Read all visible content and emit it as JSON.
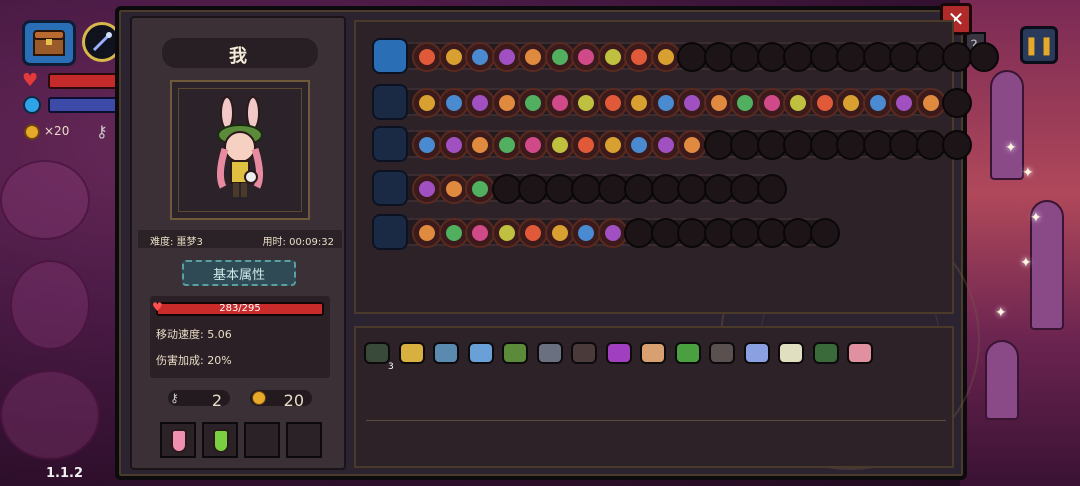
{
  "hud": {
    "coins": "×20",
    "version": "1.1.2"
  },
  "character": {
    "name": "我",
    "difficulty": "难度: 噩梦3",
    "time": "用时: 00:09:32",
    "attr_tab": "基本属性",
    "hp": "283/295",
    "move_speed": "移动速度: 5.06",
    "damage_bonus": "伤害加成: 20%",
    "keys": "2",
    "gold": "20"
  },
  "colors": {
    "hp": "#c92a2a",
    "mana": "#3d4aa8",
    "accent": "#e7a92a",
    "panel": "#2d2228"
  },
  "weapon_rows": [
    {
      "icon": "chest-icon",
      "main": true,
      "slots": 22,
      "filled": 10
    },
    {
      "icon": "wand-icon",
      "main": false,
      "slots": 21,
      "filled": 20
    },
    {
      "icon": "spear-icon",
      "main": false,
      "slots": 21,
      "filled": 11
    },
    {
      "icon": "gauntlet-icon",
      "main": false,
      "slots": 14,
      "filled": 3
    },
    {
      "icon": "staff-icon",
      "main": false,
      "slots": 16,
      "filled": 8
    }
  ],
  "items": [
    {
      "name": "armor-item",
      "color": "#3a4a3a",
      "count": "3"
    },
    {
      "name": "antler-item",
      "color": "#d8b040",
      "count": ""
    },
    {
      "name": "magnifier-item",
      "color": "#5a8ab0",
      "count": ""
    },
    {
      "name": "blue-fish-item",
      "color": "#6aa0d8",
      "count": ""
    },
    {
      "name": "green-helmet-item",
      "color": "#5a8a3a",
      "count": ""
    },
    {
      "name": "grey-gem-item",
      "color": "#6a7080",
      "count": ""
    },
    {
      "name": "dark-cloak-item",
      "color": "#4a3a3a",
      "count": ""
    },
    {
      "name": "rainbow-cape-item",
      "color": "#a040c0",
      "count": ""
    },
    {
      "name": "egg-item",
      "color": "#d8a070",
      "count": ""
    },
    {
      "name": "leaf-item",
      "color": "#4aa040",
      "count": ""
    },
    {
      "name": "bell-item",
      "color": "#5a5050",
      "count": ""
    },
    {
      "name": "lotus-item",
      "color": "#8aa0e0",
      "count": ""
    },
    {
      "name": "fang-item",
      "color": "#e0e0c0",
      "count": ""
    },
    {
      "name": "green-boot-item",
      "color": "#3a6a3a",
      "count": ""
    },
    {
      "name": "feather-item",
      "color": "#e090a0",
      "count": ""
    }
  ]
}
